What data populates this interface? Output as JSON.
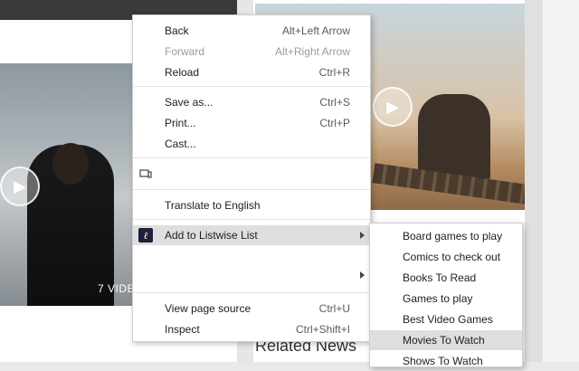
{
  "background": {
    "video_count_label": "7 VIDE",
    "related_news_heading": "Related News"
  },
  "context_menu": {
    "back_label": "Back",
    "back_shortcut": "Alt+Left Arrow",
    "forward_label": "Forward",
    "forward_shortcut": "Alt+Right Arrow",
    "reload_label": "Reload",
    "reload_shortcut": "Ctrl+R",
    "save_as_label": "Save as...",
    "save_as_shortcut": "Ctrl+S",
    "print_label": "Print...",
    "print_shortcut": "Ctrl+P",
    "cast_label": "Cast...",
    "translate_label": "Translate to English",
    "listwise_label": "Add to Listwise List",
    "view_source_label": "View page source",
    "view_source_shortcut": "Ctrl+U",
    "inspect_label": "Inspect",
    "inspect_shortcut": "Ctrl+Shift+I",
    "listwise_icon_glyph": "ℓ"
  },
  "submenu": {
    "items": [
      {
        "label": "Board games to play"
      },
      {
        "label": "Comics to check out"
      },
      {
        "label": "Books To Read"
      },
      {
        "label": "Games to play"
      },
      {
        "label": "Best Video Games"
      },
      {
        "label": "Movies To Watch"
      },
      {
        "label": "Shows To Watch"
      }
    ],
    "highlighted": "Movies To Watch"
  },
  "colors": {
    "menu_hover": "#dedede",
    "disabled_text": "#9a9a9a"
  }
}
